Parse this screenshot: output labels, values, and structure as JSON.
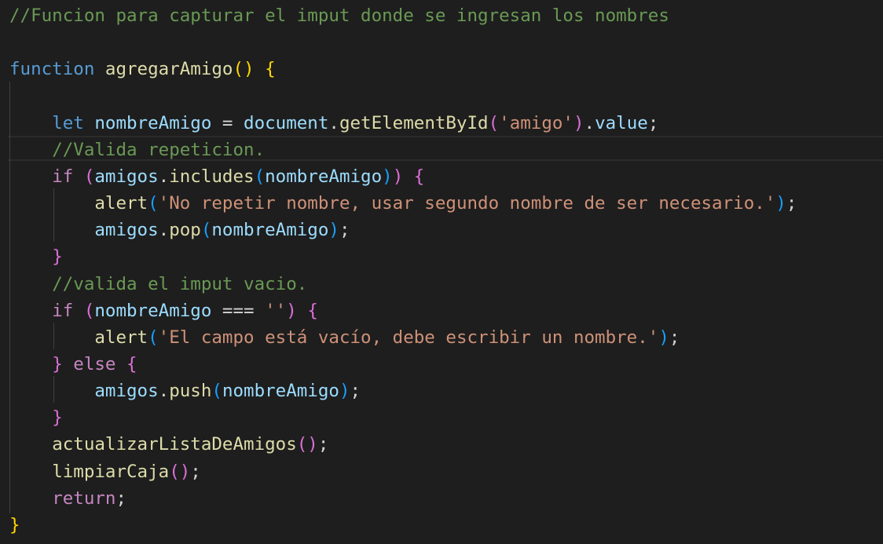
{
  "editor": {
    "theme_colors": {
      "background": "#1e1e1e",
      "comment": "#6a9955",
      "keyword": "#569cd6",
      "control_keyword": "#c586c0",
      "function": "#dcdcaa",
      "variable": "#9cdcfe",
      "string": "#ce9178",
      "plain": "#d4d4d4",
      "bracket_level_1": "#ffd700",
      "bracket_level_2": "#da70d6",
      "bracket_level_3": "#179fff"
    },
    "lines": [
      {
        "tokens": [
          {
            "text": "//Funcion para capturar el imput donde se ingresan los nombres",
            "kind": "cm"
          }
        ]
      },
      {
        "tokens": []
      },
      {
        "tokens": [
          {
            "text": "function",
            "kind": "kw"
          },
          {
            "text": " ",
            "kind": "pl"
          },
          {
            "text": "agregarAmigo",
            "kind": "fn"
          },
          {
            "text": "()",
            "kind": "b1"
          },
          {
            "text": " ",
            "kind": "pl"
          },
          {
            "text": "{",
            "kind": "b1"
          }
        ]
      },
      {
        "tokens": []
      },
      {
        "tokens": [
          {
            "text": "    ",
            "kind": "pl"
          },
          {
            "text": "let",
            "kind": "kw"
          },
          {
            "text": " ",
            "kind": "pl"
          },
          {
            "text": "nombreAmigo",
            "kind": "vr"
          },
          {
            "text": " = ",
            "kind": "pl"
          },
          {
            "text": "document",
            "kind": "vr"
          },
          {
            "text": ".",
            "kind": "pl"
          },
          {
            "text": "getElementById",
            "kind": "fn"
          },
          {
            "text": "(",
            "kind": "b2"
          },
          {
            "text": "'amigo'",
            "kind": "st"
          },
          {
            "text": ")",
            "kind": "b2"
          },
          {
            "text": ".",
            "kind": "pl"
          },
          {
            "text": "value",
            "kind": "vr"
          },
          {
            "text": ";",
            "kind": "pl"
          }
        ]
      },
      {
        "tokens": [
          {
            "text": "    ",
            "kind": "pl"
          },
          {
            "text": "//Valida repeticion.",
            "kind": "cm"
          }
        ]
      },
      {
        "tokens": [
          {
            "text": "    ",
            "kind": "pl"
          },
          {
            "text": "if",
            "kind": "kc"
          },
          {
            "text": " ",
            "kind": "pl"
          },
          {
            "text": "(",
            "kind": "b2"
          },
          {
            "text": "amigos",
            "kind": "vr"
          },
          {
            "text": ".",
            "kind": "pl"
          },
          {
            "text": "includes",
            "kind": "fn"
          },
          {
            "text": "(",
            "kind": "b3"
          },
          {
            "text": "nombreAmigo",
            "kind": "vr"
          },
          {
            "text": ")",
            "kind": "b3"
          },
          {
            "text": ")",
            "kind": "b2"
          },
          {
            "text": " ",
            "kind": "pl"
          },
          {
            "text": "{",
            "kind": "b2"
          }
        ]
      },
      {
        "tokens": [
          {
            "text": "        ",
            "kind": "pl"
          },
          {
            "text": "alert",
            "kind": "fn"
          },
          {
            "text": "(",
            "kind": "b3"
          },
          {
            "text": "'No repetir nombre, usar segundo nombre de ser necesario.'",
            "kind": "st"
          },
          {
            "text": ")",
            "kind": "b3"
          },
          {
            "text": ";",
            "kind": "pl"
          }
        ]
      },
      {
        "tokens": [
          {
            "text": "        ",
            "kind": "pl"
          },
          {
            "text": "amigos",
            "kind": "vr"
          },
          {
            "text": ".",
            "kind": "pl"
          },
          {
            "text": "pop",
            "kind": "fn"
          },
          {
            "text": "(",
            "kind": "b3"
          },
          {
            "text": "nombreAmigo",
            "kind": "vr"
          },
          {
            "text": ")",
            "kind": "b3"
          },
          {
            "text": ";",
            "kind": "pl"
          }
        ]
      },
      {
        "tokens": [
          {
            "text": "    ",
            "kind": "pl"
          },
          {
            "text": "}",
            "kind": "b2"
          }
        ]
      },
      {
        "tokens": [
          {
            "text": "    ",
            "kind": "pl"
          },
          {
            "text": "//valida el imput vacio.",
            "kind": "cm"
          }
        ]
      },
      {
        "tokens": [
          {
            "text": "    ",
            "kind": "pl"
          },
          {
            "text": "if",
            "kind": "kc"
          },
          {
            "text": " ",
            "kind": "pl"
          },
          {
            "text": "(",
            "kind": "b2"
          },
          {
            "text": "nombreAmigo",
            "kind": "vr"
          },
          {
            "text": " === ",
            "kind": "pl"
          },
          {
            "text": "''",
            "kind": "st"
          },
          {
            "text": ")",
            "kind": "b2"
          },
          {
            "text": " ",
            "kind": "pl"
          },
          {
            "text": "{",
            "kind": "b2"
          }
        ]
      },
      {
        "tokens": [
          {
            "text": "        ",
            "kind": "pl"
          },
          {
            "text": "alert",
            "kind": "fn"
          },
          {
            "text": "(",
            "kind": "b3"
          },
          {
            "text": "'El campo está vacío, debe escribir un nombre.'",
            "kind": "st"
          },
          {
            "text": ")",
            "kind": "b3"
          },
          {
            "text": ";",
            "kind": "pl"
          }
        ]
      },
      {
        "tokens": [
          {
            "text": "    ",
            "kind": "pl"
          },
          {
            "text": "}",
            "kind": "b2"
          },
          {
            "text": " ",
            "kind": "pl"
          },
          {
            "text": "else",
            "kind": "kc"
          },
          {
            "text": " ",
            "kind": "pl"
          },
          {
            "text": "{",
            "kind": "b2"
          }
        ]
      },
      {
        "tokens": [
          {
            "text": "        ",
            "kind": "pl"
          },
          {
            "text": "amigos",
            "kind": "vr"
          },
          {
            "text": ".",
            "kind": "pl"
          },
          {
            "text": "push",
            "kind": "fn"
          },
          {
            "text": "(",
            "kind": "b3"
          },
          {
            "text": "nombreAmigo",
            "kind": "vr"
          },
          {
            "text": ")",
            "kind": "b3"
          },
          {
            "text": ";",
            "kind": "pl"
          }
        ]
      },
      {
        "tokens": [
          {
            "text": "    ",
            "kind": "pl"
          },
          {
            "text": "}",
            "kind": "b2"
          }
        ]
      },
      {
        "tokens": [
          {
            "text": "    ",
            "kind": "pl"
          },
          {
            "text": "actualizarListaDeAmigos",
            "kind": "fn"
          },
          {
            "text": "()",
            "kind": "b2"
          },
          {
            "text": ";",
            "kind": "pl"
          }
        ]
      },
      {
        "tokens": [
          {
            "text": "    ",
            "kind": "pl"
          },
          {
            "text": "limpiarCaja",
            "kind": "fn"
          },
          {
            "text": "()",
            "kind": "b2"
          },
          {
            "text": ";",
            "kind": "pl"
          }
        ]
      },
      {
        "tokens": [
          {
            "text": "    ",
            "kind": "pl"
          },
          {
            "text": "return",
            "kind": "kc"
          },
          {
            "text": ";",
            "kind": "pl"
          }
        ]
      },
      {
        "tokens": [
          {
            "text": "}",
            "kind": "b1"
          }
        ]
      }
    ]
  }
}
